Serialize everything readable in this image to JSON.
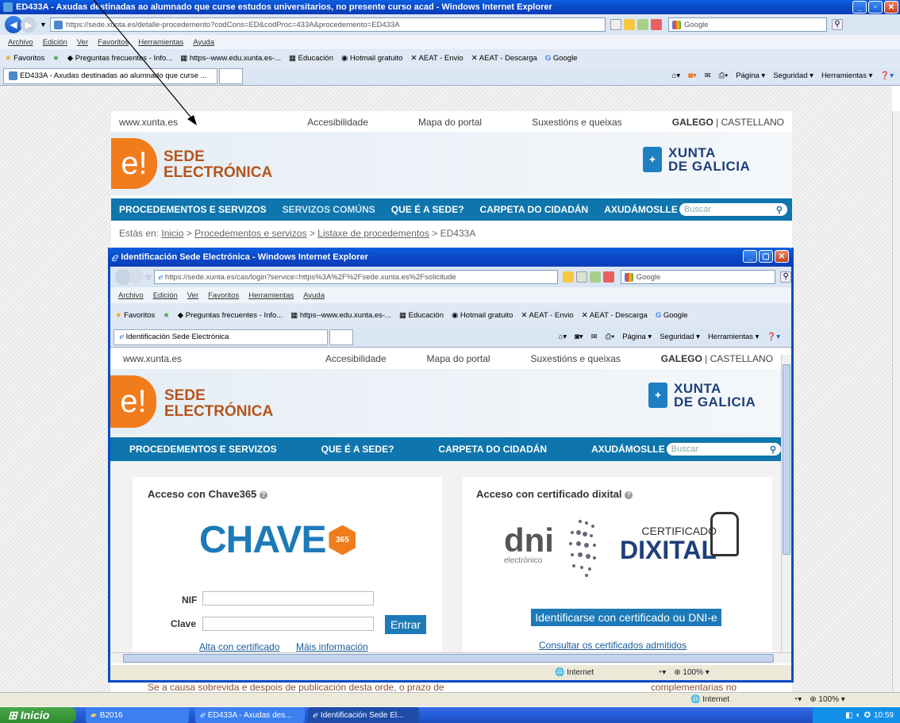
{
  "outer": {
    "title": "ED433A - Axudas destinadas ao alumnado que curse estudos universitarios, no presente curso acad - Windows Internet Explorer",
    "url": "https://sede.xunta.es/detalle-procedemento?codCons=ED&codProc=433A&procedemento=ED433A",
    "search_placeholder": "Google",
    "menu": [
      "Archivo",
      "Edición",
      "Ver",
      "Favoritos",
      "Herramientas",
      "Ayuda"
    ],
    "favorites_label": "Favoritos",
    "favorites": [
      "Preguntas frecuentes - Info...",
      "https--www.edu.xunta.es-...",
      "Educación",
      "Hotmail gratuito",
      "AEAT - Envio",
      "AEAT - Descarga",
      "Google"
    ],
    "tab": "ED433A - Axudas destinadas ao alumnado que curse ...",
    "tools": [
      "Página",
      "Seguridad",
      "Herramientas"
    ],
    "status_internet": "Internet",
    "zoom": "100%",
    "bg_text_left": "Se a causa sobrevida e despois de publicación desta orde, o prazo de",
    "bg_text_right": "complementarias no"
  },
  "sede_outer": {
    "top_links": [
      "www.xunta.es",
      "Accesibilidade",
      "Mapa do portal",
      "Suxestións e queixas"
    ],
    "lang_galego": "GALEGO",
    "lang_sep": " | ",
    "lang_castellano": "CASTELLANO",
    "logo": "e!",
    "title_line1": "SEDE",
    "title_line2": "ELECTRÓNICA",
    "xunta_line1": "XUNTA",
    "xunta_line2": "DE GALICIA",
    "nav": [
      "PROCEDEMENTOS E SERVIZOS",
      "SERVIZOS COMÚNS",
      "QUE É A SEDE?",
      "CARPETA DO CIDADÁN",
      "AXUDÁMOSLLE"
    ],
    "search": "Buscar",
    "breadcrumb_prefix": "Estás en:",
    "breadcrumb": [
      "Inicio",
      "Procedementos e servizos",
      "Listaxe de procedementos"
    ],
    "breadcrumb_current": "ED433A"
  },
  "inner": {
    "title": "Identificación Sede Electrónica - Windows Internet Explorer",
    "url": "https://sede.xunta.es/cas/login?service=https%3A%2F%2Fsede.xunta.es%2Fsolicitude",
    "search_placeholder": "Google",
    "tab": "Identificación Sede Electrónica",
    "status_internet": "Internet",
    "zoom": "100%"
  },
  "sede_inner": {
    "nav": [
      "PROCEDEMENTOS E SERVIZOS",
      "QUE É A SEDE?",
      "CARPETA DO CIDADÁN",
      "AXUDÁMOSLLE"
    ],
    "search": "Buscar",
    "chave": {
      "heading": "Acceso con Chave365",
      "logo": "CHAVE",
      "badge": "365",
      "nif_label": "NIF",
      "clave_label": "Clave",
      "submit": "Entrar",
      "link_alta": "Alta con certificado",
      "link_info": "Máis información"
    },
    "cert": {
      "heading": "Acceso con certificado dixital",
      "dni": "dni",
      "dni_sub": "electrónico",
      "cert_line1": "CERTIFICADO",
      "cert_line2": "DIXITAL",
      "button": "Identificarse con certificado ou DNI-e",
      "link": "Consultar os certificados admitidos"
    }
  },
  "taskbar": {
    "start": "Inicio",
    "items": [
      "B2016",
      "ED433A - Axudas des...",
      "Identificación Sede El..."
    ],
    "clock": "10:59"
  },
  "colors": {
    "accent_orange": "#f07c1c",
    "nav_blue": "#0f75ad",
    "xp_blue": "#0a48c7"
  }
}
